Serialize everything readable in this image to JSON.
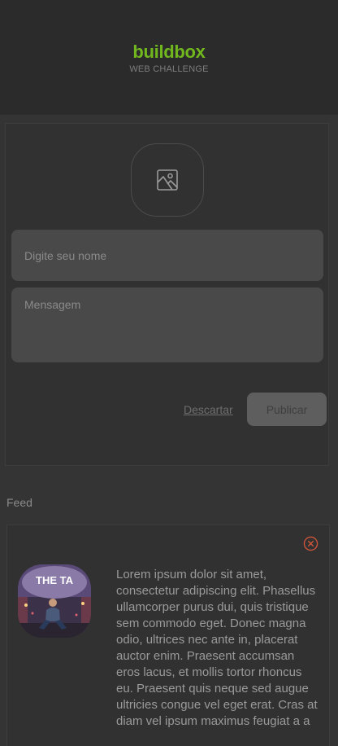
{
  "header": {
    "logo": "buildbox",
    "subtitle": "WEB CHALLENGE"
  },
  "composer": {
    "image_icon": "image-icon",
    "name_placeholder": "Digite seu nome",
    "message_placeholder": "Mensagem",
    "discard_label": "Descartar",
    "publish_label": "Publicar"
  },
  "feed": {
    "label": "Feed",
    "posts": [
      {
        "photo_caption": "THE TA",
        "delete_icon": "close-circle-icon",
        "message": "Lorem ipsum dolor sit amet, consectetur adipiscing elit. Phasellus ullamcorper purus dui, quis tristique sem commodo eget. Donec magna odio, ultrices nec ante in, placerat auctor enim. Praesent accumsan eros lacus, et mollis tortor rhoncus eu. Praesent quis neque sed augue ultricies congue vel eget erat. Cras at diam vel ipsum maximus feugiat a a"
      }
    ]
  },
  "colors": {
    "brand": "#71b81f",
    "background": "#343434",
    "header": "#2b2b2b",
    "input": "#494949",
    "delete": "#d2553a"
  }
}
